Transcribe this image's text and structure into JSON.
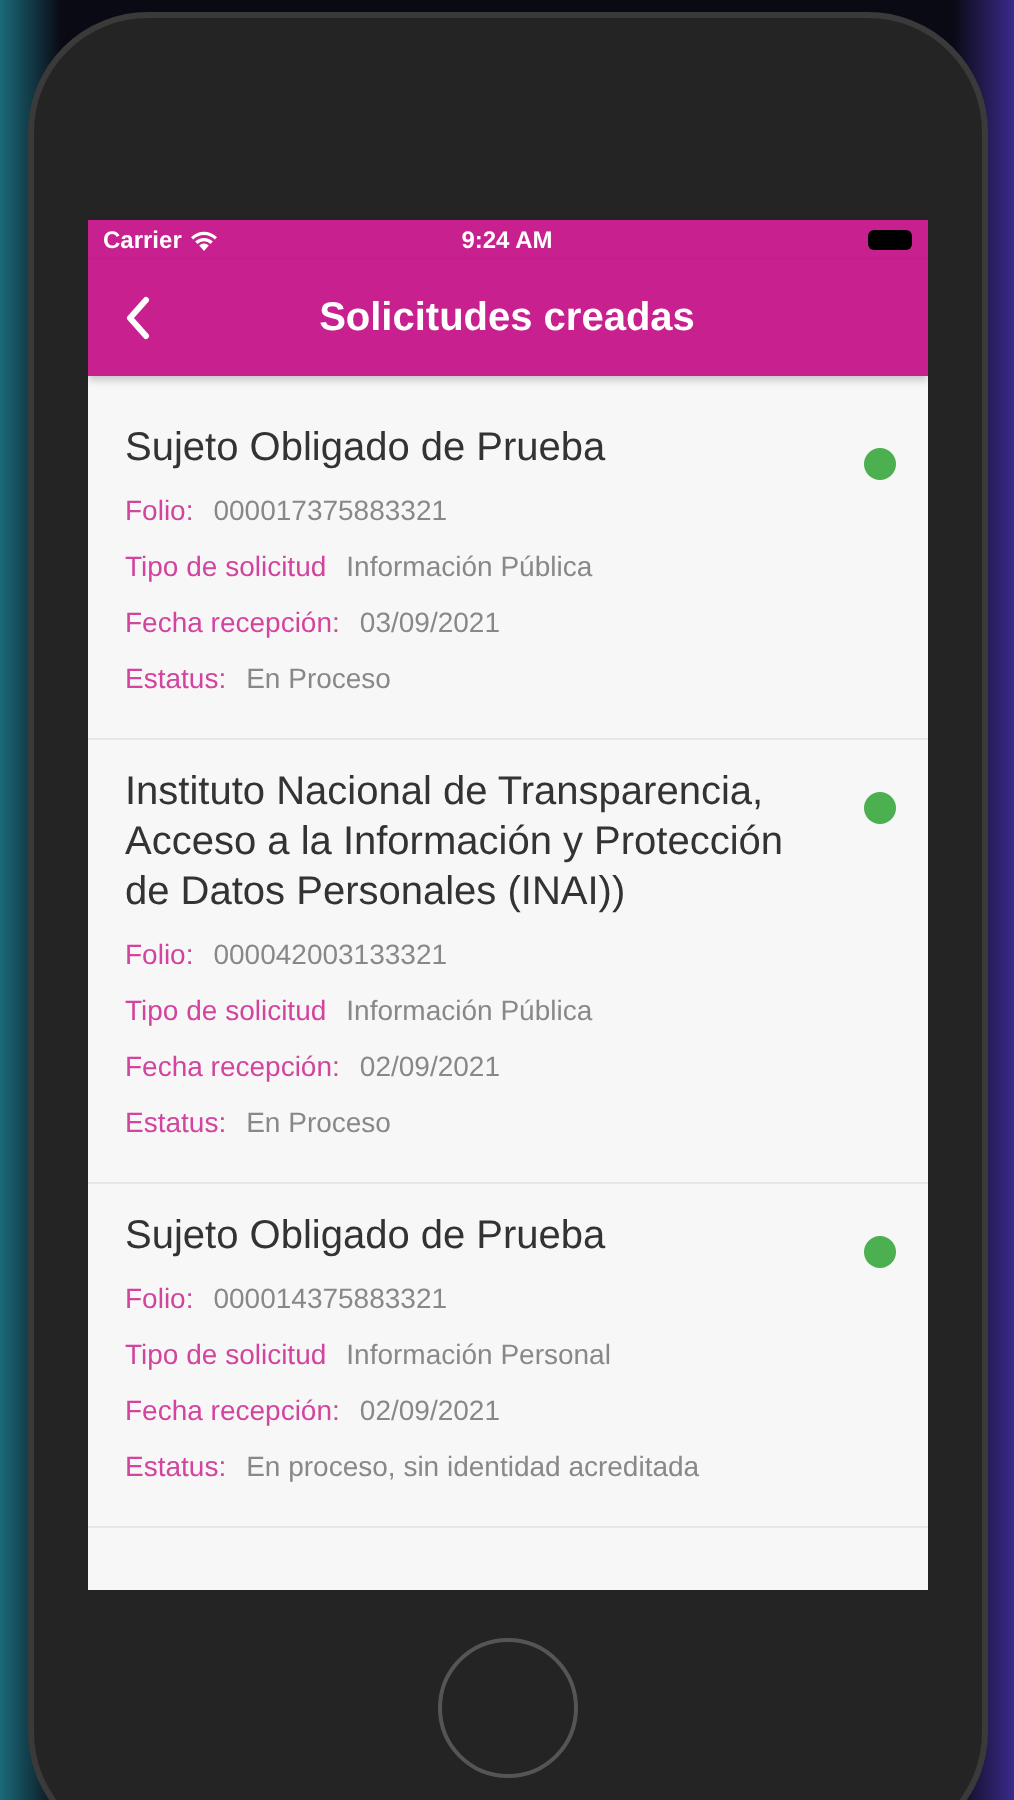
{
  "status_bar": {
    "carrier": "Carrier",
    "time": "9:24 AM"
  },
  "nav": {
    "title": "Solicitudes creadas"
  },
  "requests": [
    {
      "title": "Sujeto Obligado de Prueba",
      "color": "#4caf50",
      "fields": [
        {
          "label": "Folio:",
          "value": "000017375883321"
        },
        {
          "label": "Tipo de solicitud",
          "value": "Información Pública"
        },
        {
          "label": "Fecha recepción:",
          "value": "03/09/2021"
        },
        {
          "label": "Estatus:",
          "value": "En Proceso"
        }
      ]
    },
    {
      "title": "Instituto Nacional de Transparencia, Acceso a la Información y Protección de Datos Personales (INAI))",
      "color": "#4caf50",
      "fields": [
        {
          "label": "Folio:",
          "value": "000042003133321"
        },
        {
          "label": "Tipo de solicitud",
          "value": "Información Pública"
        },
        {
          "label": "Fecha recepción:",
          "value": "02/09/2021"
        },
        {
          "label": "Estatus:",
          "value": "En Proceso"
        }
      ]
    },
    {
      "title": "Sujeto Obligado de Prueba",
      "color": "#4caf50",
      "fields": [
        {
          "label": "Folio:",
          "value": "000014375883321"
        },
        {
          "label": "Tipo de solicitud",
          "value": "Información Personal"
        },
        {
          "label": "Fecha recepción:",
          "value": "02/09/2021"
        },
        {
          "label": "Estatus:",
          "value": "En proceso, sin identidad acreditada"
        }
      ]
    }
  ]
}
